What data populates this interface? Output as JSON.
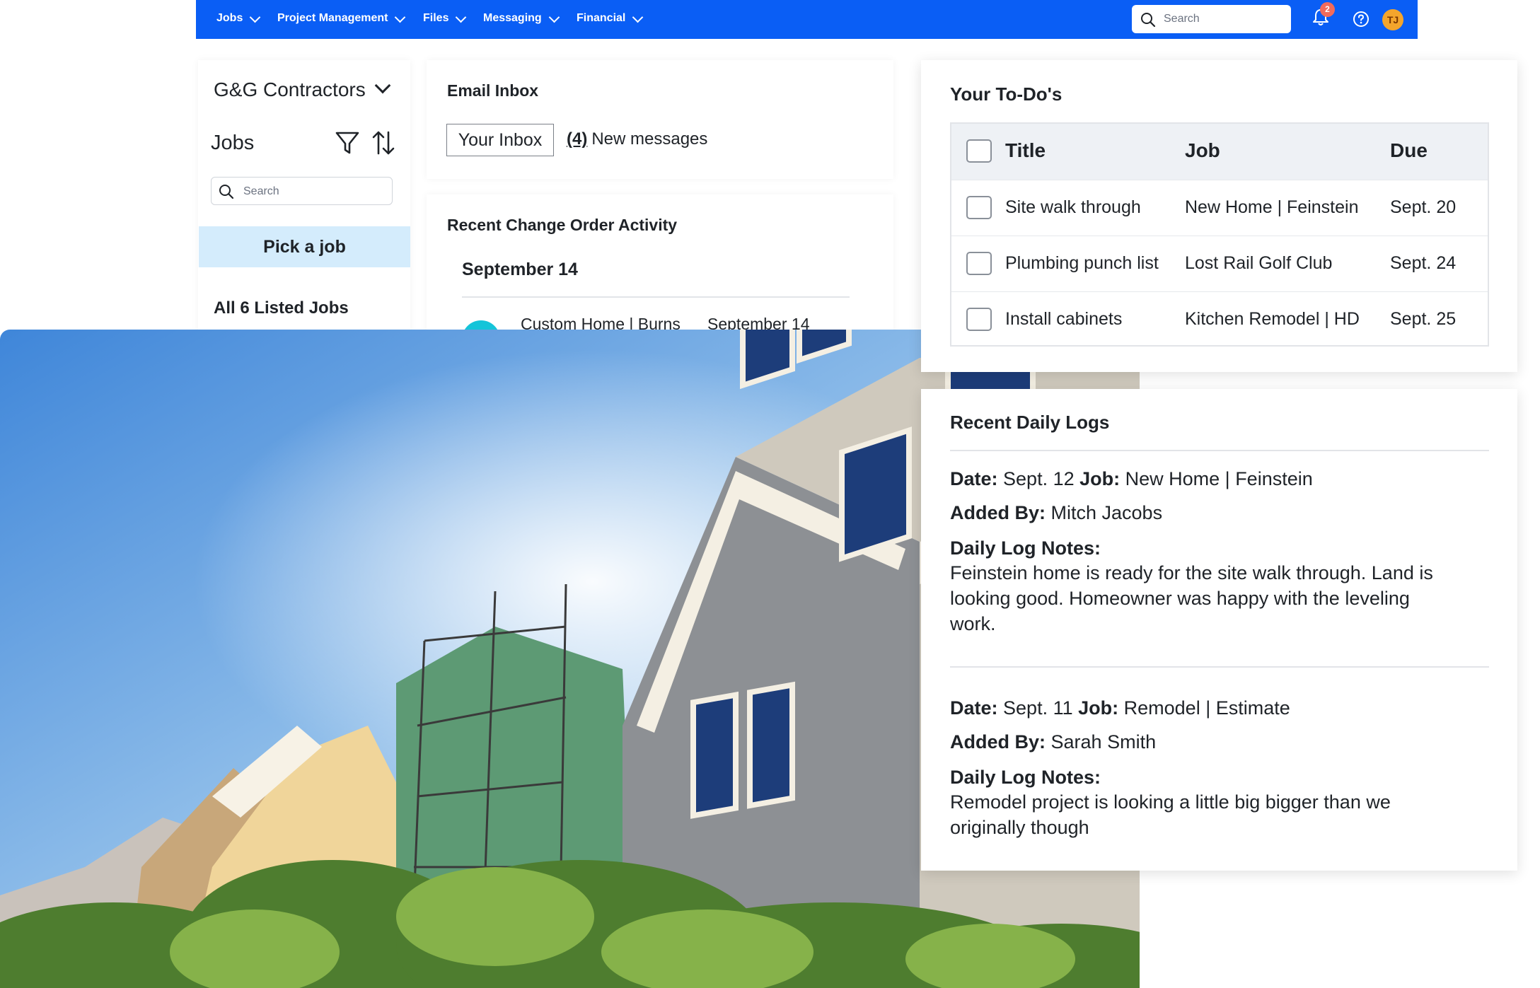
{
  "nav": {
    "items": [
      "Jobs",
      "Project Management",
      "Files",
      "Messaging",
      "Financial"
    ],
    "search_placeholder": "Search",
    "notification_count": "2",
    "user_initials": "TJ",
    "accent_color": "#0a5ef5"
  },
  "sidebar": {
    "company": "G&G Contractors",
    "jobs_title": "Jobs",
    "search_placeholder": "Search",
    "pick_job_label": "Pick a job",
    "all_jobs_label": "All 6 Listed Jobs"
  },
  "email": {
    "title": "Email Inbox",
    "inbox_button": "Your Inbox",
    "new_count": "(4)",
    "new_label": "New messages"
  },
  "change_orders": {
    "title": "Recent Change Order Activity",
    "date_heading": "September 14",
    "items": [
      {
        "job": "Custom Home | Burns",
        "date": "September 14"
      }
    ]
  },
  "todos": {
    "title": "Your To-Do's",
    "columns": [
      "Title",
      "Job",
      "Due"
    ],
    "rows": [
      {
        "title": "Site walk through",
        "job": "New Home | Feinstein",
        "due": "Sept. 20"
      },
      {
        "title": "Plumbing punch list",
        "job": "Lost Rail Golf Club",
        "due": "Sept. 24"
      },
      {
        "title": "Install cabinets",
        "job": "Kitchen Remodel | HD",
        "due": "Sept. 25"
      }
    ]
  },
  "daily_logs": {
    "title": "Recent Daily Logs",
    "date_label": "Date:",
    "job_label": "Job:",
    "added_by_label": "Added By:",
    "notes_label": "Daily Log Notes:",
    "entries": [
      {
        "date": "Sept. 12",
        "job": "New Home | Feinstein",
        "added_by": "Mitch Jacobs",
        "notes": "Feinstein home is ready for the site walk through. Land is looking good. Homeowner was happy with the leveling work."
      },
      {
        "date": "Sept. 11",
        "job": "Remodel | Estimate",
        "added_by": "Sarah Smith",
        "notes": "Remodel project is looking a little big bigger than we originally though"
      }
    ]
  }
}
